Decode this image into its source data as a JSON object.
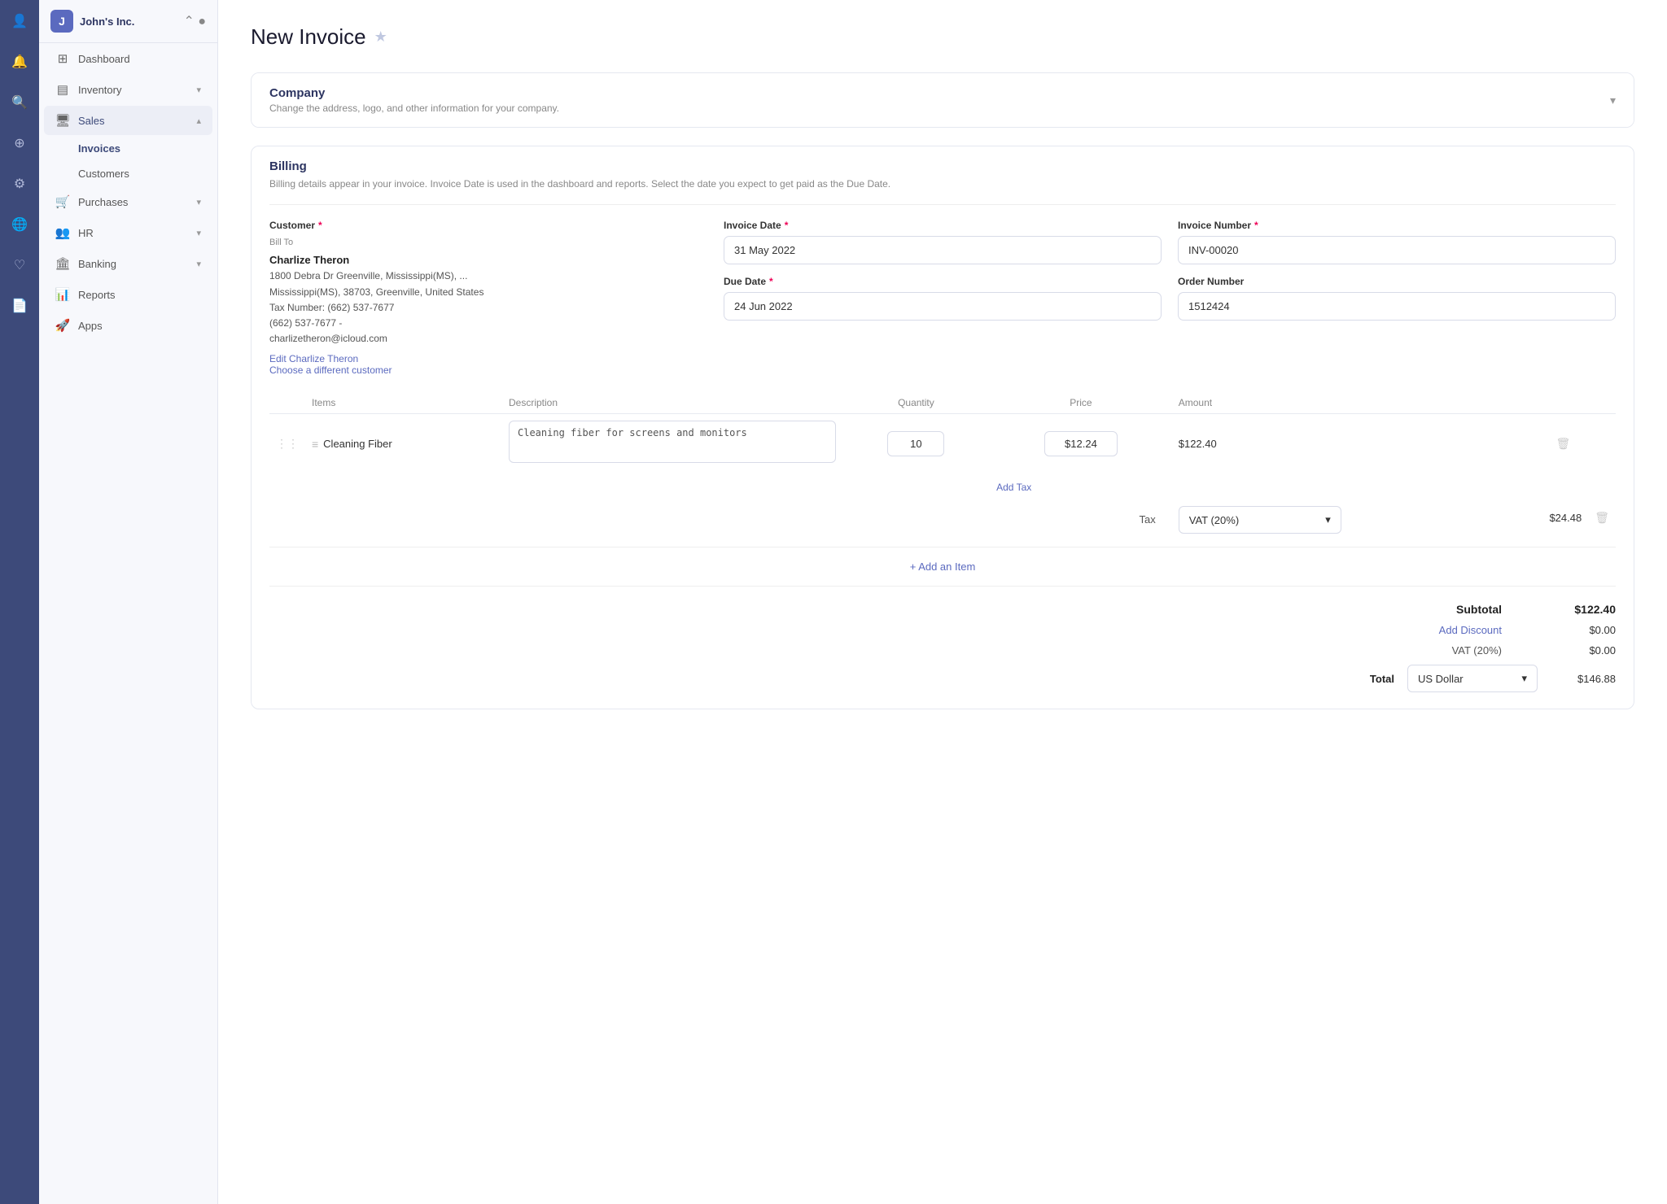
{
  "company": {
    "name": "John's Inc.",
    "logo_letter": "J"
  },
  "icon_sidebar": {
    "icons": [
      {
        "name": "person-icon",
        "symbol": "👤"
      },
      {
        "name": "bell-icon",
        "symbol": "🔔"
      },
      {
        "name": "search-icon",
        "symbol": "🔍"
      },
      {
        "name": "plus-circle-icon",
        "symbol": "⊕"
      },
      {
        "name": "gear-icon",
        "symbol": "⚙"
      },
      {
        "name": "globe-icon",
        "symbol": "🌐"
      },
      {
        "name": "heart-icon",
        "symbol": "♡"
      },
      {
        "name": "document-icon",
        "symbol": "📄"
      }
    ]
  },
  "nav": {
    "dashboard_label": "Dashboard",
    "inventory_label": "Inventory",
    "sales_label": "Sales",
    "invoices_label": "Invoices",
    "customers_label": "Customers",
    "purchases_label": "Purchases",
    "hr_label": "HR",
    "banking_label": "Banking",
    "reports_label": "Reports",
    "apps_label": "Apps"
  },
  "page": {
    "title": "New Invoice",
    "company_section": {
      "heading": "Company",
      "subtitle": "Change the address, logo, and other information for your company."
    },
    "billing_section": {
      "heading": "Billing",
      "subtitle": "Billing details appear in your invoice. Invoice Date is used in the dashboard and reports. Select the date you expect to get paid as the Due Date."
    }
  },
  "billing": {
    "customer_label": "Customer",
    "bill_to": "Bill To",
    "customer_name": "Charlize Theron",
    "customer_address": "1800 Debra Dr Greenville, Mississippi(MS), ...",
    "customer_address2": "Mississippi(MS), 38703, Greenville, United States",
    "customer_tax": "Tax Number: (662) 537-7677",
    "customer_phone": "(662) 537-7677  -",
    "customer_email": "charlizetheron@icloud.com",
    "edit_link": "Edit Charlize Theron",
    "choose_link": "Choose a different customer",
    "invoice_date_label": "Invoice Date",
    "invoice_date_value": "31 May 2022",
    "invoice_number_label": "Invoice Number",
    "invoice_number_value": "INV-00020",
    "due_date_label": "Due Date",
    "due_date_value": "24 Jun 2022",
    "order_number_label": "Order Number",
    "order_number_value": "1512424"
  },
  "items_table": {
    "col_items": "Items",
    "col_description": "Description",
    "col_quantity": "Quantity",
    "col_price": "Price",
    "col_amount": "Amount",
    "rows": [
      {
        "name": "Cleaning Fiber",
        "description": "Cleaning fiber for screens and monitors",
        "quantity": "10",
        "price": "$12.24",
        "amount": "$122.40"
      }
    ],
    "add_tax_label": "Add Tax",
    "tax_label": "Tax",
    "tax_option": "VAT (20%)",
    "tax_amount": "$24.48",
    "add_item_label": "+ Add an Item"
  },
  "totals": {
    "subtotal_label": "Subtotal",
    "subtotal_value": "$122.40",
    "discount_label": "Add Discount",
    "discount_value": "$0.00",
    "vat_label": "VAT (20%)",
    "vat_value": "$0.00",
    "total_label": "Total",
    "currency_label": "US Dollar",
    "total_value": "$146.88"
  }
}
